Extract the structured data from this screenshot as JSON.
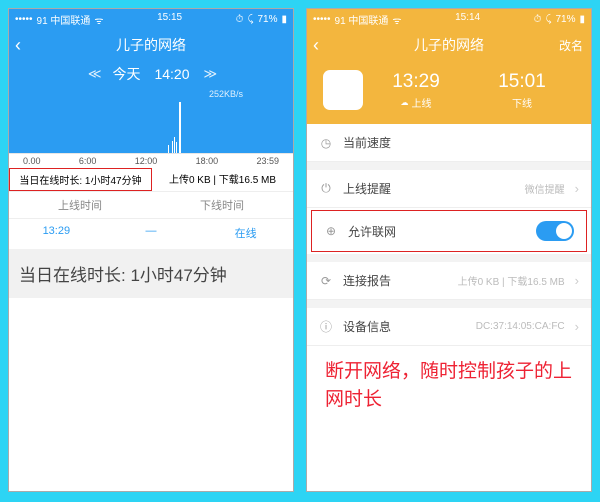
{
  "left": {
    "status": {
      "carrier": "91 中国联通",
      "time": "15:15",
      "battery": "71%"
    },
    "title": "儿子的网络",
    "date_label": "今天",
    "date_time": "14:20",
    "speed": "252KB/s",
    "axis": [
      "0.00",
      "6:00",
      "12:00",
      "18:00",
      "23:59"
    ],
    "sum_a": "当日在线时长: 1小时47分钟",
    "sum_b": "上传0 KB | 下载16.5 MB",
    "tab_hdr": [
      "上线时间",
      "下线时间"
    ],
    "tab_val": [
      "13:29",
      "—",
      "在线"
    ],
    "bigmsg": "当日在线时长: 1小时47分钟"
  },
  "right": {
    "status": {
      "carrier": "91 中国联通",
      "time": "15:14",
      "battery": "71%"
    },
    "title": "儿子的网络",
    "nav_right": "改名",
    "hero": {
      "on_t": "13:29",
      "on_l": "上线",
      "off_t": "15:01",
      "off_l": "下线"
    },
    "rows": {
      "speed_l": "当前速度",
      "notify_l": "上线提醒",
      "notify_v": "微信提醒",
      "allow_l": "允许联网",
      "report_l": "连接报告",
      "report_v": "上传0 KB | 下载16.5 MB",
      "device_l": "设备信息",
      "device_v": "DC:37:14:05:CA:FC"
    },
    "redtxt": "断开网络，随时控制孩子的上网时长"
  },
  "chart_data": {
    "type": "bar",
    "title": "",
    "categories_hours_0_to_24": true,
    "series": [
      {
        "name": "network-activity",
        "x": [
          13.3,
          13.5,
          13.6,
          13.7,
          14.2
        ],
        "heights_pct": [
          15,
          22,
          30,
          20,
          95
        ]
      }
    ],
    "xlabels": [
      "0.00",
      "6:00",
      "12:00",
      "18:00",
      "23:59"
    ]
  }
}
